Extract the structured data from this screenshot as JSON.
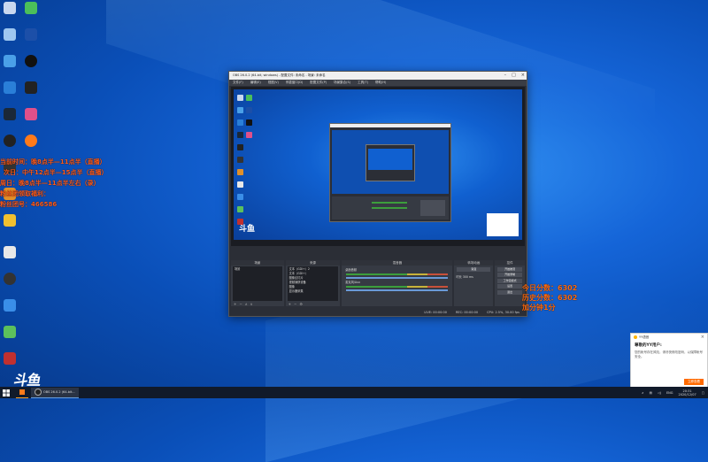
{
  "overlay_left": {
    "line1": "当前时间：晚8点半—11点半（直播）",
    "line2": "次日：中午12点半—15点半（直播）",
    "line3": "周日：晚8点半—11点半左右（录）",
    "line4": "粉丝团领取福利：",
    "line5": "粉丝团号：466586"
  },
  "overlay_right": {
    "line1": "今日分数：6302",
    "line2": "历史分数：6302",
    "line3": "加分钟1分"
  },
  "obs": {
    "title": "OBS 26.0.2 (64-bit, windows) - 配置文件: 未命名 - 场景: 未命名",
    "menu": [
      "文件(F)",
      "编辑(E)",
      "视图(V)",
      "停靠窗口(D)",
      "配置文件(P)",
      "场景集合(S)",
      "工具(T)",
      "帮助(H)"
    ],
    "docks": {
      "scenes": "场景",
      "sources": "来源",
      "mixer": "混音器",
      "transitions": "转场动画",
      "controls": "控件"
    },
    "scene_item": "场景",
    "source_items": [
      "文本（GDI+）2",
      "文本（GDI+）",
      "图像幻灯片",
      "视频捕获设备",
      "图像",
      "显示器采集"
    ],
    "mixer_channels": [
      "桌面音频",
      "麦克风/Aux"
    ],
    "transition_value": "渐变",
    "duration_label": "时长",
    "duration_value": "300 ms",
    "controls": [
      "开始推流",
      "开始录制",
      "工作室模式",
      "设置",
      "退出"
    ],
    "status": {
      "live": "LIVE: 00:00:00",
      "rec": "REC: 00:00:00",
      "cpu": "CPU: 2.5%, 30.00 fps"
    }
  },
  "popup": {
    "app": "YY语音",
    "title": "尊敬的YY用户:",
    "text": "您的帐号存在风险，请尽快修改密码，以保障帐号安全。",
    "button": "立即查看"
  },
  "taskbar": {
    "app1": "OBS 26.0.2 (64-bit...",
    "lang": "ENG",
    "time": "20:31",
    "date": "2020/12/07"
  },
  "logo_text": "斗鱼",
  "colors": {
    "overlay_orange": "#ff5a1a",
    "desktop_blue": "#1565d8",
    "obs_dark": "#2b2e36"
  }
}
